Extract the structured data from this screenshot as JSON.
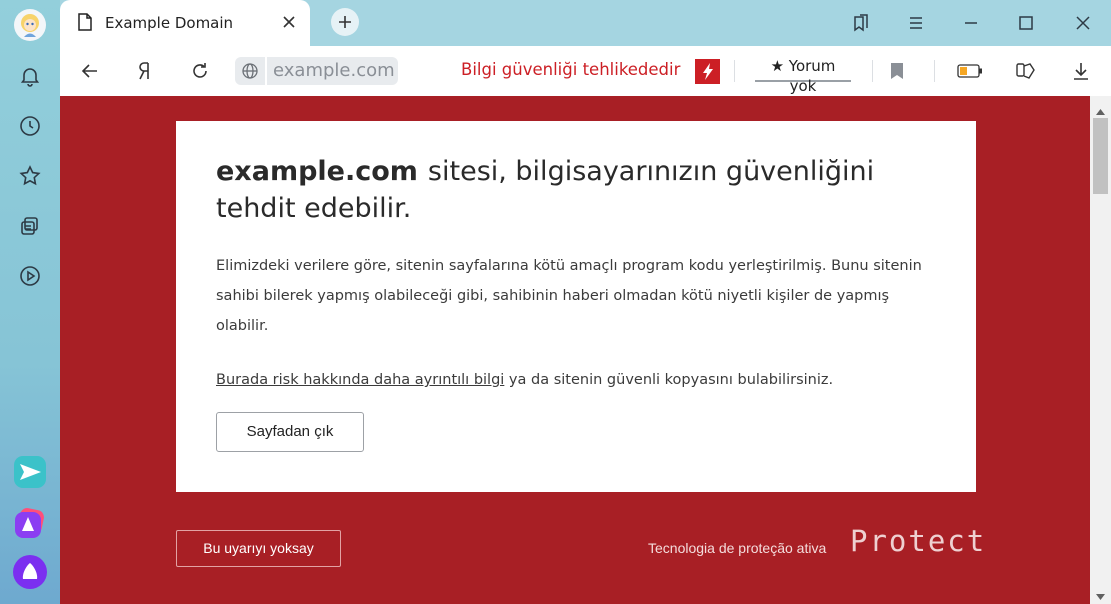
{
  "tab": {
    "title": "Example Domain"
  },
  "toolbar": {
    "url": "example.com",
    "security_warning": "Bilgi güvenliği tehlikededir",
    "comments_label": "★ Yorum yok"
  },
  "warning_page": {
    "domain": "example.com",
    "headline_rest": "sitesi, bilgisayarınızın güvenliğini tehdit edebilir.",
    "paragraph": "Elimizdeki verilere göre, sitenin sayfalarına kötü amaçlı program kodu yerleştirilmiş. Bunu sitenin sahibi bilerek yapmış olabileceği gibi, sahibinin haberi olmadan kötü niyetli kişiler de yapmış olabilir.",
    "risk_link": "Burada risk hakkında daha ayrıntılı bilgi",
    "risk_suffix": " ya da sitenin güvenli kopyasını bulabilirsiniz.",
    "leave_button": "Sayfadan çık",
    "ignore_button": "Bu uyarıyı yoksay",
    "protect_label": "Tecnologia de proteção ativa",
    "protect_logo": "Protect"
  },
  "colors": {
    "page_background": "#a81f25",
    "warning_red": "#cc1f25",
    "sidebar": "#8fcfdc"
  },
  "icons": {
    "sidebar": [
      "bell-icon",
      "history-icon",
      "star-icon",
      "collections-icon",
      "play-icon",
      "messenger-icon",
      "alice-apps-icon",
      "alice-icon"
    ],
    "toolbar": [
      "back-icon",
      "yandex-icon",
      "reload-icon",
      "globe-icon",
      "flash-icon",
      "bookmark-icon",
      "battery-icon",
      "extensions-icon",
      "download-icon"
    ]
  }
}
